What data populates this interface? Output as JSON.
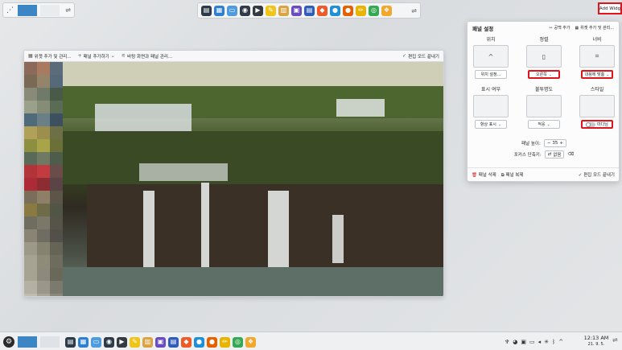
{
  "top_panel": {
    "app_icon": "kde-icon",
    "handle": "⇌",
    "add_widget_label": "Add Widg"
  },
  "dock_apps": [
    {
      "icon": "desktop-icon",
      "glyph": "▤",
      "color": "#2d3a4a"
    },
    {
      "icon": "store-icon",
      "glyph": "▦",
      "color": "#2f7fd0"
    },
    {
      "icon": "folder-icon",
      "glyph": "▭",
      "color": "#4f9be0"
    },
    {
      "icon": "disc-icon",
      "glyph": "◉",
      "color": "#2f3a4a"
    },
    {
      "icon": "terminal-icon",
      "glyph": "▶",
      "color": "#343b43"
    },
    {
      "icon": "notes-icon",
      "glyph": "✎",
      "color": "#f0c419"
    },
    {
      "icon": "archive-icon",
      "glyph": "▥",
      "color": "#d9a441"
    },
    {
      "icon": "image-viewer-icon",
      "glyph": "▣",
      "color": "#6a4cc0"
    },
    {
      "icon": "document-icon",
      "glyph": "▤",
      "color": "#2f5db8"
    },
    {
      "icon": "brave-icon",
      "glyph": "◆",
      "color": "#f05a28"
    },
    {
      "icon": "browser-icon",
      "glyph": "●",
      "color": "#1e90d8"
    },
    {
      "icon": "firefox-icon",
      "glyph": "●",
      "color": "#e66000"
    },
    {
      "icon": "pencil-icon",
      "glyph": "✏",
      "color": "#e8b400"
    },
    {
      "icon": "chrome-icon",
      "glyph": "◎",
      "color": "#34a853"
    },
    {
      "icon": "update-icon",
      "glyph": "❖",
      "color": "#f2a72d"
    }
  ],
  "panel_window": {
    "toolbar": {
      "add_widgets": "위젯 추가 및 관리...",
      "add_panel": "패널 추가하기",
      "manage_panels": "바탕 화면과 패널 관리...",
      "exit_edit": "편집 모드 끝내기"
    },
    "pixel_colors": [
      "#8c6a5b",
      "#a97a60",
      "#5b6b7a",
      "#7a6a55",
      "#94846a",
      "#55697a",
      "#8a8a78",
      "#6f7a6a",
      "#4a5a48",
      "#9aa08a",
      "#868c76",
      "#5a6b56",
      "#4f6a7a",
      "#6a7f86",
      "#3d5060",
      "#b0a058",
      "#9c8f4d",
      "#6d7044",
      "#8c8f40",
      "#a7a449",
      "#6b7038",
      "#5a6a58",
      "#707a62",
      "#4e5c4c",
      "#b2333a",
      "#c23b3e",
      "#6a4c4a",
      "#ac2b36",
      "#8e2c34",
      "#5b4446",
      "#7a6d5a",
      "#8f7f66",
      "#5c5548",
      "#8a7a40",
      "#6f6a47",
      "#505545",
      "#6f6c60",
      "#7b7869",
      "#565449",
      "#8a8474",
      "#6f6d62",
      "#525049",
      "#9c9988",
      "#85826f",
      "#666455",
      "#a7a392",
      "#8e8b79",
      "#6e6c5e",
      "#a6a393",
      "#8d8a7b",
      "#6a6859",
      "#b4b1a2",
      "#9a978a",
      "#7c7a6e",
      "#c0bdb0",
      "#a8a598",
      "#8a887b"
    ]
  },
  "panel_settings": {
    "title": "패널 설정",
    "shortcut_add": "공백 추가",
    "widget_manage": "위젯 추가 및 관리...",
    "location": {
      "label": "위치",
      "control": "위치 설정..."
    },
    "alignment": {
      "label": "정렬",
      "control": "오른쪽"
    },
    "width": {
      "label": "너비",
      "control": "내용에 맞춤"
    },
    "visibility": {
      "label": "표시 여부",
      "control": "항상 표시"
    },
    "opacity": {
      "label": "불투명도",
      "control": "적응"
    },
    "style": {
      "label": "스타일",
      "control": "떠다님"
    },
    "panel_height": {
      "label": "패널 높이:",
      "value": "35"
    },
    "focus_shortcut": {
      "label": "포커스 단축키:",
      "value": "없음"
    },
    "footer": {
      "delete_panel": "패널 삭제",
      "duplicate_panel": "패널 복제",
      "exit_edit": "편집 모드 끝내기"
    }
  },
  "bottom_panel": {
    "menu_glyph": "⚙",
    "tray": {
      "time": "12:13 AM",
      "date": "21. 9. 5."
    },
    "tray_icons": [
      {
        "icon": "clipboard-icon",
        "glyph": "♆"
      },
      {
        "icon": "color-picker-icon",
        "glyph": "◕"
      },
      {
        "icon": "network-icon",
        "glyph": "▣"
      },
      {
        "icon": "display-icon",
        "glyph": "▭"
      },
      {
        "icon": "volume-icon",
        "glyph": "◂"
      },
      {
        "icon": "brightness-icon",
        "glyph": "✳"
      },
      {
        "icon": "bluetooth-icon",
        "glyph": "ᛒ"
      },
      {
        "icon": "expand-icon",
        "glyph": "^"
      }
    ],
    "handle": "⇌"
  }
}
